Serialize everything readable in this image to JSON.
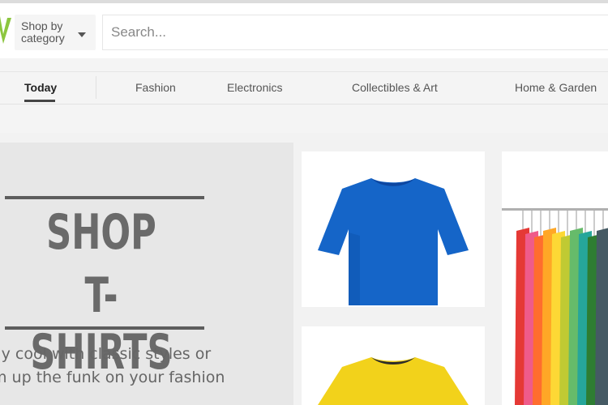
{
  "header": {
    "shop_by_category": "Shop by category",
    "search_placeholder": "Search..."
  },
  "nav": {
    "items": [
      "Today",
      "Fashion",
      "Electronics",
      "Collectibles & Art",
      "Home & Garden"
    ],
    "active": "Today"
  },
  "hero": {
    "title_line1": "SHOP",
    "title_line2": "T-SHIRTS",
    "subtitle_line1": "ay cool with classic styles or",
    "subtitle_line2": "m up the funk on your fashion"
  },
  "colors": {
    "logo_green": "#8cc63f",
    "shirt_blue": "#1565c8",
    "shirt_yellow": "#f2d21b",
    "hero_text": "#6a6a6a",
    "rack_colors": [
      "#e53935",
      "#ef5b8a",
      "#ff6d2e",
      "#ffa726",
      "#fdd835",
      "#c0ca33",
      "#66bb6a",
      "#26a69a",
      "#2e7d32",
      "#455a64"
    ]
  },
  "icons": {
    "caret": "chevron-down-icon",
    "logo": "logo-icon"
  }
}
